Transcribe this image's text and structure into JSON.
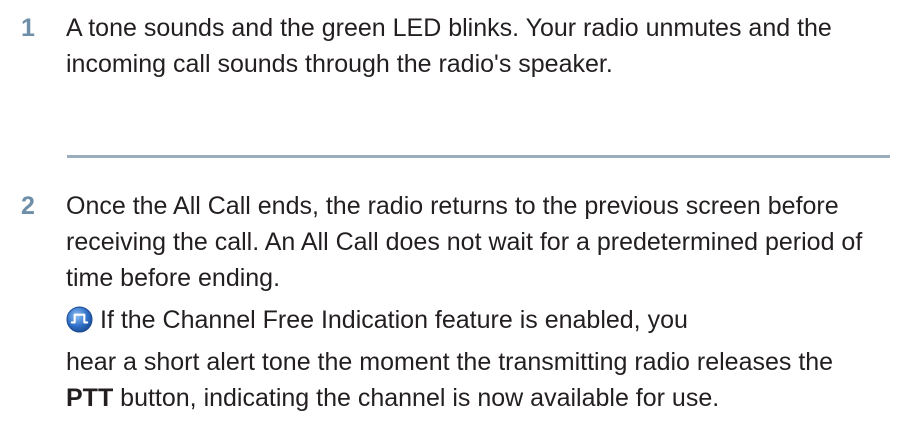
{
  "steps": [
    {
      "number": "1",
      "text": "A tone sounds and the green LED blinks. Your radio unmutes and the incoming call sounds through the radio's speaker."
    },
    {
      "number": "2",
      "text": "Once the All Call ends, the radio returns to the previous screen before receiving the call. An All Call does not wait for a predetermined period of time before ending."
    }
  ],
  "note": {
    "icon": "channel-free-indication-icon",
    "line1": "If the Channel Free Indication feature is enabled, you",
    "text_before_bold": "hear a short alert tone the moment the transmitting radio releases the",
    "bold": "PTT",
    "text_after_bold": "button, indicating the channel is now available for use."
  },
  "colors": {
    "step_number": "#6f8fa8",
    "divider": "#9aaebf",
    "icon_blue": "#2f6fc8"
  }
}
